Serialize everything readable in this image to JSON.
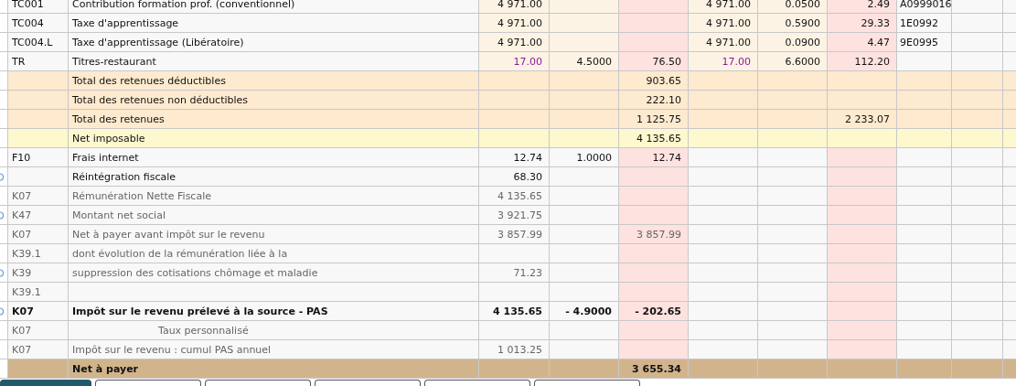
{
  "table": {
    "rows": [
      {
        "kind": "contribution",
        "marker": false,
        "code": "TC001",
        "label": "Contribution formation prof. (conventionnel)",
        "column_3": "4 971.00",
        "column_6": "4 971.00",
        "column_7": "0.0500",
        "column_8": "2.49",
        "column_9": "A0999016"
      },
      {
        "kind": "contribution",
        "marker": false,
        "code": "TC004",
        "label": "Taxe d'apprentissage",
        "column_3": "4 971.00",
        "column_6": "4 971.00",
        "column_7": "0.5900",
        "column_8": "29.33",
        "column_9": "1E0992"
      },
      {
        "kind": "contribution",
        "marker": false,
        "code": "TC004.L",
        "label": "Taxe d'apprentissage (Libératoire)",
        "column_3": "4 971.00",
        "column_6": "4 971.00",
        "column_7": "0.0900",
        "column_8": "4.47",
        "column_9": "9E0995"
      },
      {
        "kind": "quantity",
        "marker": false,
        "code": "TR",
        "label": "Titres-restaurant",
        "column_3": "17.00",
        "column_4": "4.5000",
        "column_5": "76.50",
        "column_6": "17.00",
        "column_7": "6.6000",
        "column_8": "112.20"
      },
      {
        "kind": "total",
        "marker": false,
        "label": "Total des retenues déductibles",
        "column_5": "903.65"
      },
      {
        "kind": "total",
        "marker": false,
        "label": "Total des retenues non déductibles",
        "column_5": "222.10"
      },
      {
        "kind": "total",
        "marker": false,
        "label": "Total des retenues",
        "column_5": "1 125.75",
        "column_8": "2 233.07"
      },
      {
        "kind": "net-taxable",
        "marker": false,
        "label": "Net imposable",
        "column_5": "4 135.65"
      },
      {
        "kind": "line",
        "marker": false,
        "code": "F10",
        "label": "Frais internet",
        "column_3": "12.74",
        "column_4": "1.0000",
        "column_5": "12.74"
      },
      {
        "kind": "line",
        "marker": true,
        "label": "Réintégration fiscale",
        "column_3": "68.30"
      },
      {
        "kind": "info",
        "marker": false,
        "code": "K07",
        "label": "Rémunération Nette Fiscale",
        "column_3": "4 135.65"
      },
      {
        "kind": "info",
        "marker": true,
        "code": "K47",
        "label": "Montant net social",
        "column_3": "3 921.75"
      },
      {
        "kind": "info",
        "marker": false,
        "code": "K07",
        "label": "Net à payer avant impôt sur le revenu",
        "column_3": "3 857.99",
        "column_5": "3 857.99"
      },
      {
        "kind": "info",
        "marker": false,
        "code": "K39.1",
        "label": "dont évolution de la rémunération liée à la"
      },
      {
        "kind": "info",
        "marker": true,
        "code": "K39",
        "label": "suppression des cotisations chômage et maladie",
        "column_3": "71.23"
      },
      {
        "kind": "info",
        "marker": false,
        "code": "K39.1"
      },
      {
        "kind": "bold",
        "marker": true,
        "code": "K07",
        "label": "Impôt sur le revenu prélevé à la source - PAS",
        "column_3": "4 135.65",
        "column_4": "- 4.9000",
        "column_5": "- 202.65"
      },
      {
        "kind": "info",
        "marker": false,
        "code": "K07",
        "label": "Taux personnalisé",
        "indented": true
      },
      {
        "kind": "info",
        "marker": false,
        "code": "K07",
        "label": "Impôt sur le revenu : cumul PAS annuel",
        "column_3": "1 013.25"
      },
      {
        "kind": "net-pay",
        "marker": false,
        "label": "Net à payer",
        "column_5": "3 655.34"
      }
    ]
  },
  "tabs": [
    {
      "selected": true
    },
    {
      "selected": false
    },
    {
      "selected": false
    },
    {
      "selected": false
    },
    {
      "selected": false
    },
    {
      "selected": false
    }
  ]
}
